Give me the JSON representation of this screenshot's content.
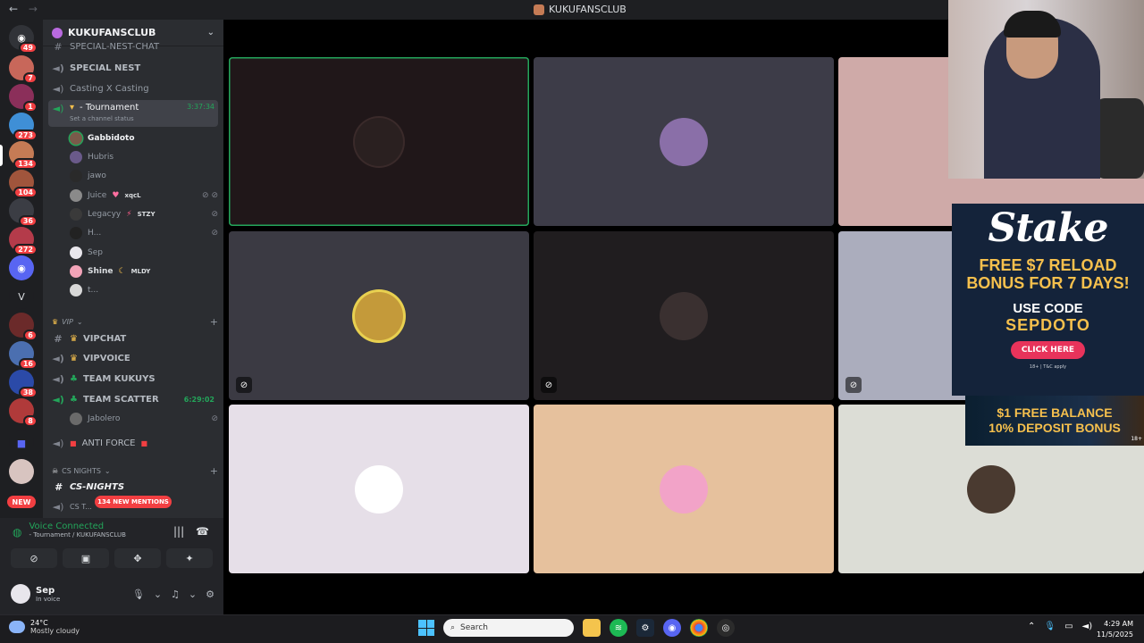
{
  "topbar": {
    "title": "KUKUFANSCLUB",
    "back": "←",
    "forward": "→"
  },
  "rail": {
    "servers": [
      {
        "badge": "49"
      },
      {
        "badge": "7"
      },
      {
        "badge": "1"
      },
      {
        "badge": "273"
      },
      {
        "badge": "134"
      },
      {
        "badge": "104"
      },
      {
        "badge": "36"
      },
      {
        "badge": "272"
      },
      {
        "badge": ""
      },
      {
        "badge": ""
      },
      {
        "badge": "6"
      },
      {
        "badge": "16"
      },
      {
        "badge": "38"
      },
      {
        "badge": "8"
      },
      {
        "badge": ""
      },
      {
        "badge": ""
      }
    ],
    "letter_server": "V",
    "new_label": "NEW"
  },
  "sidebar": {
    "server_name": "KUKUFANSCLUB",
    "channels": {
      "special_chat": "SPECIAL-NEST-CHAT",
      "special_nest": "SPECIAL NEST",
      "casting": "Casting X Casting",
      "tournament": "- Tournament",
      "tournament_time": "3:37:34",
      "tournament_status": "Set a channel status"
    },
    "voice_users": [
      {
        "name": "Gabbidoto",
        "tag": ""
      },
      {
        "name": "Hubris",
        "tag": ""
      },
      {
        "name": "jawo",
        "tag": ""
      },
      {
        "name": "Juice",
        "tag": "xqcL"
      },
      {
        "name": "Legacyy",
        "tag": "STZY"
      },
      {
        "name": "H...",
        "tag": ""
      },
      {
        "name": "Sep",
        "tag": ""
      },
      {
        "name": "Shine",
        "tag": "MLDY"
      },
      {
        "name": "t...",
        "tag": ""
      }
    ],
    "vip_category": "VIP",
    "vip_channels": {
      "vipchat": "VIPCHAT",
      "vipvoice": "VIPVOICE",
      "team_kukuys": "TEAM KUKUYS",
      "team_scatter": "TEAM SCATTER",
      "team_scatter_time": "6:29:02",
      "jabolero": "Jabolero",
      "anti_force": "ANTI FORCE"
    },
    "cs_category": "CS NIGHTS",
    "cs_channels": {
      "cs_nights": "CS-NIGHTS",
      "cs_t": "CS T..."
    },
    "mentions_pill": "134 NEW MENTIONS"
  },
  "voice_panel": {
    "status": "Voice Connected",
    "channel": "- Tournament / KUKUFANSCLUB",
    "user_name": "Sep",
    "user_status": "In voice"
  },
  "ad": {
    "logo": "Stake",
    "line1": "FREE $7 RELOAD",
    "line2": "BONUS FOR 7 DAYS!",
    "line3": "USE CODE",
    "code": "SEPDOTO",
    "cta": "CLICK HERE",
    "fine": "18+ | T&C apply"
  },
  "ad2": {
    "line1": "$1 FREE BALANCE",
    "line2": "10% DEPOSIT BONUS",
    "age": "18+"
  },
  "taskbar": {
    "temp": "24°C",
    "condition": "Mostly cloudy",
    "search_placeholder": "Search",
    "time": "4:29 AM",
    "date": "11/5/2025"
  },
  "colors": {
    "accent_green": "#23a55a",
    "mention_red": "#f23f42",
    "ad_gold": "#f6c04d"
  }
}
